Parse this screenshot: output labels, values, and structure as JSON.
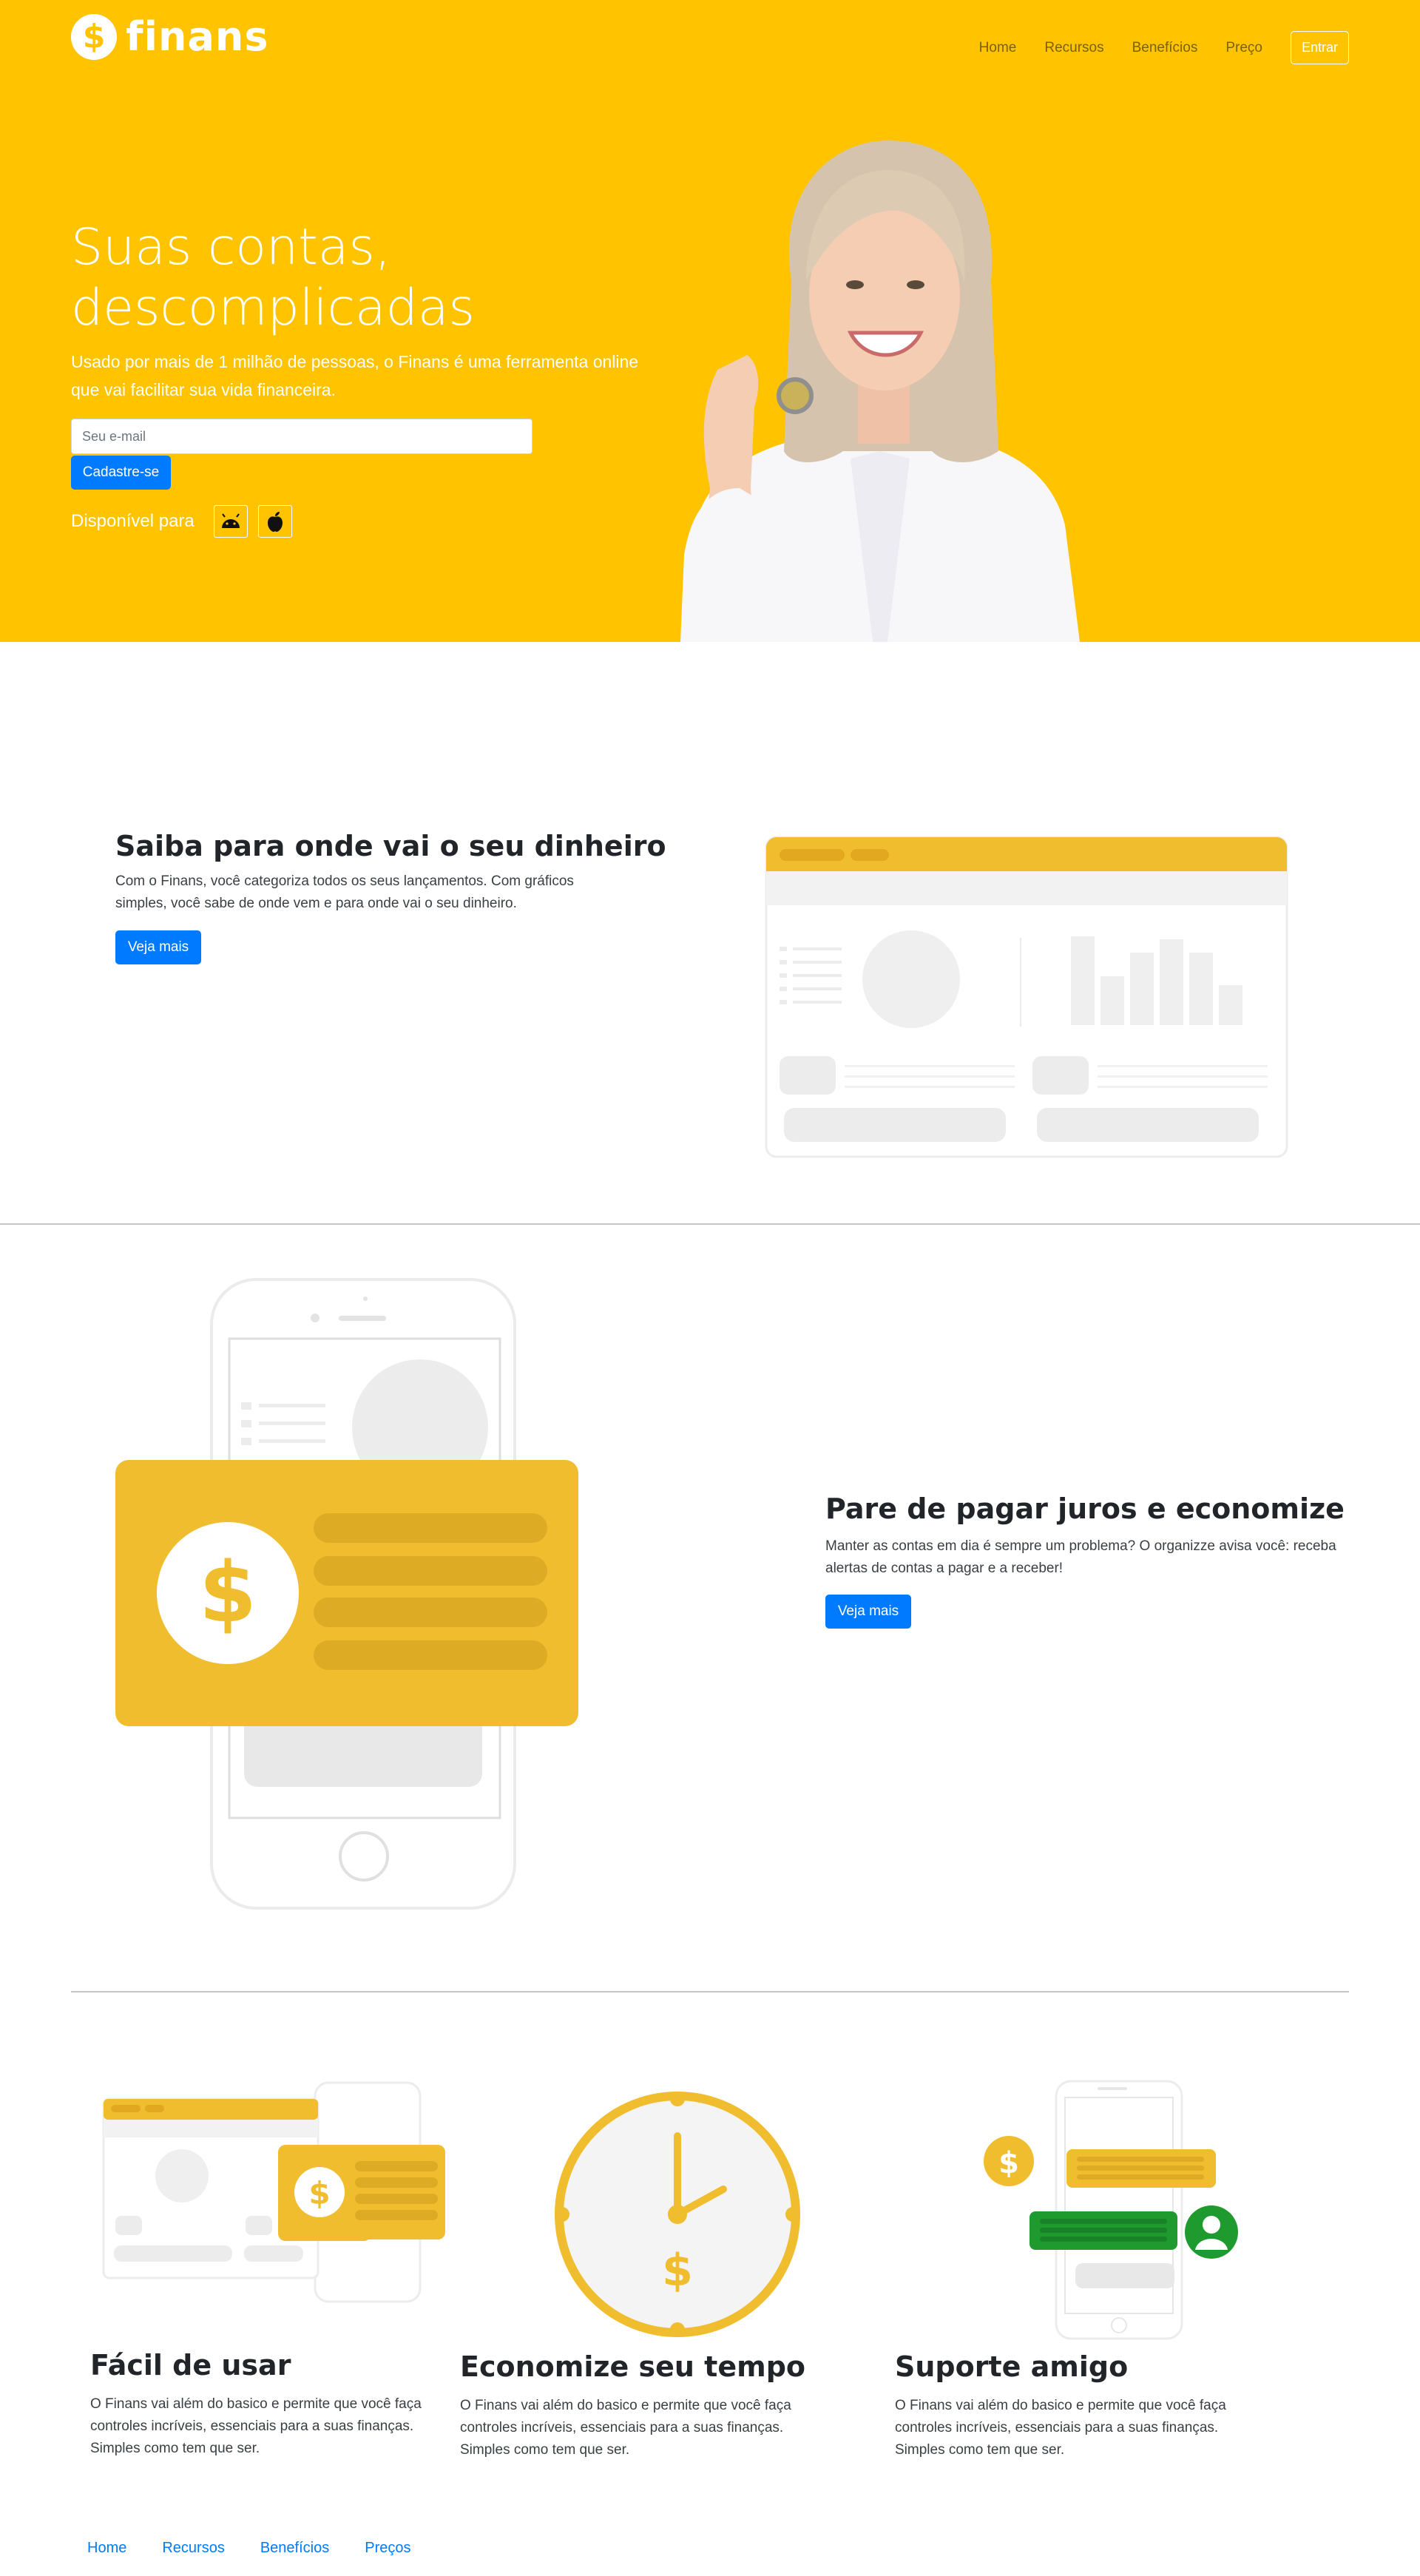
{
  "brand": {
    "name": "finans",
    "symbol": "$"
  },
  "colors": {
    "brand_yellow": "#ffc300",
    "accent_blue": "#007bff",
    "illustration_yellow": "#f0bd2e",
    "support_green": "#1e9a2e"
  },
  "nav": {
    "items": [
      {
        "label": "Home"
      },
      {
        "label": "Recursos"
      },
      {
        "label": "Benefícios"
      },
      {
        "label": "Preço"
      }
    ],
    "login_label": "Entrar"
  },
  "hero": {
    "title": "Suas contas, descomplicadas",
    "subtitle": "Usado por mais de 1 milhão de pessoas, o Finans é uma ferramenta online que vai facilitar sua vida financeira.",
    "email_placeholder": "Seu e-mail",
    "signup_label": "Cadastre-se",
    "available_label": "Disponível para",
    "stores": [
      {
        "icon": "android-icon"
      },
      {
        "icon": "apple-icon"
      }
    ]
  },
  "section_money": {
    "title": "Saiba para onde vai o seu dinheiro",
    "text": "Com o Finans, você categoriza todos os seus lançamentos. Com gráficos simples, você sabe de onde vem e para onde vai o seu dinheiro.",
    "button_label": "Veja mais"
  },
  "section_interest": {
    "title": "Pare de pagar juros e economize",
    "text": "Manter as contas em dia é sempre um problema? O organizze avisa você: receba alertas de contas a pagar e a receber!",
    "button_label": "Veja mais"
  },
  "features": [
    {
      "title": "Fácil de usar",
      "text": "O Finans vai além do basico e permite que você faça controles incríveis, essenciais para a suas finanças. Simples como tem que ser.",
      "icon": "dashboard-illustration"
    },
    {
      "title": "Economize seu tempo",
      "text": "O Finans vai além do basico e permite que você faça controles incríveis, essenciais para a suas finanças. Simples como tem que ser.",
      "icon": "clock-icon"
    },
    {
      "title": "Suporte amigo",
      "text": "O Finans vai além do basico e permite que você faça controles incríveis, essenciais para a suas finanças. Simples como tem que ser.",
      "icon": "chat-illustration"
    }
  ],
  "footer": {
    "links": [
      {
        "label": "Home"
      },
      {
        "label": "Recursos"
      },
      {
        "label": "Benefícios"
      },
      {
        "label": "Preços"
      }
    ]
  }
}
